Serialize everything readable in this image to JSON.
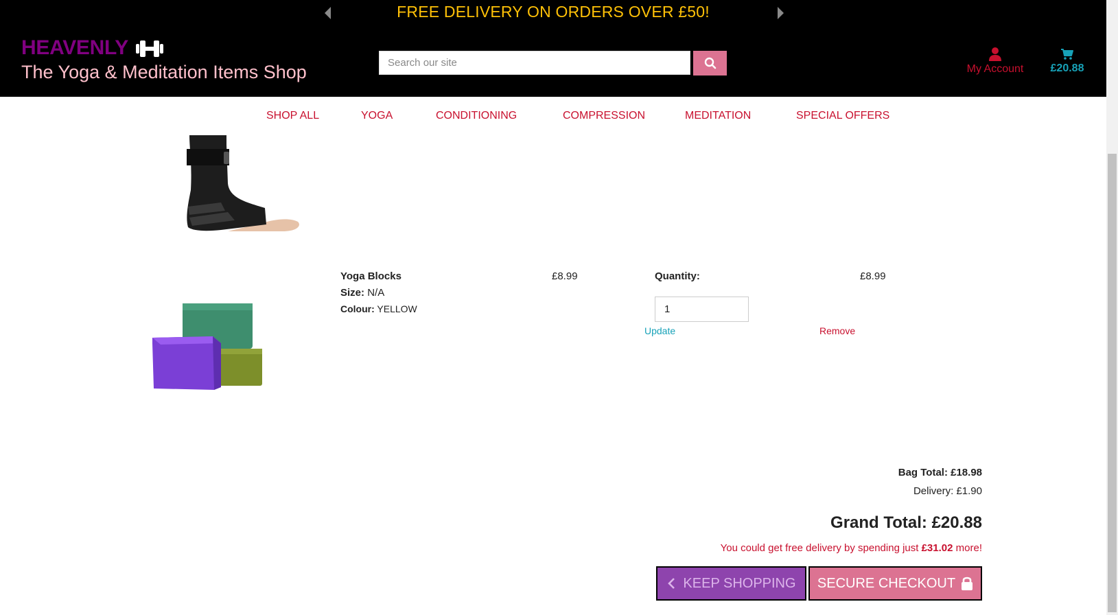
{
  "header": {
    "promo_text": "FREE DELIVERY ON ORDERS OVER £50!",
    "brand_name": "HEAVENLY",
    "brand_tagline": "The Yoga & Meditation Items Shop",
    "search_placeholder": "Search our site",
    "account_label": "My Account",
    "cart_total": "£20.88"
  },
  "nav": {
    "items": [
      "SHOP ALL",
      "YOGA",
      "CONDITIONING",
      "COMPRESSION",
      "MEDITATION",
      "SPECIAL OFFERS"
    ]
  },
  "bag": {
    "items": [
      {
        "image": "ankle-compression-sleeve"
      },
      {
        "name": "Yoga Blocks",
        "size_label": "Size:",
        "size": "N/A",
        "colour_label": "Colour:",
        "colour": "YELLOW",
        "price": "£8.99",
        "quantity_label": "Quantity:",
        "quantity": "1",
        "subtotal": "£8.99",
        "update_label": "Update",
        "remove_label": "Remove",
        "image": "yoga-blocks"
      }
    ]
  },
  "totals": {
    "bag_total": "Bag Total: £18.98",
    "delivery": "Delivery: £1.90",
    "grand_total": "Grand Total: £20.88",
    "free_delivery_prefix": "You could get free delivery by spending just ",
    "free_delivery_amount": "£31.02",
    "free_delivery_suffix": " more!"
  },
  "actions": {
    "keep_shopping": "KEEP SHOPPING",
    "secure_checkout": "SECURE CHECKOUT"
  },
  "colors": {
    "banner_bg": "#000000",
    "promo": "#ffc107",
    "brand": "#800080",
    "tagline": "#ffc0cb",
    "accent_red": "#c8102e",
    "teal": "#17a2b8",
    "pink_button": "#dc7392",
    "purple_button": "#8e44ad"
  }
}
